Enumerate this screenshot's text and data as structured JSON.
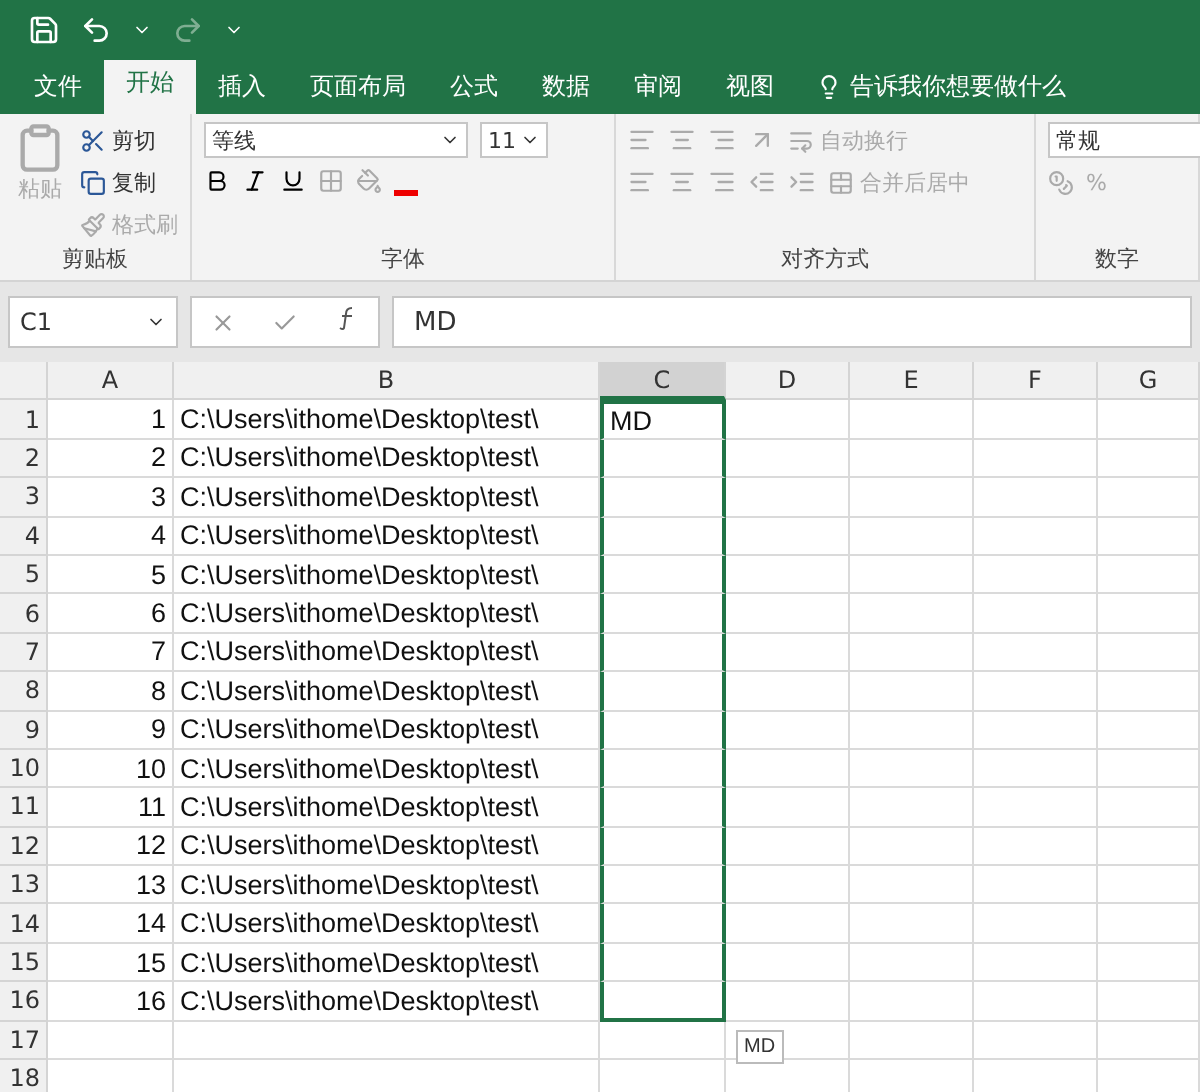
{
  "tabs": [
    {
      "label": "文件",
      "selected": false
    },
    {
      "label": "开始",
      "selected": true
    },
    {
      "label": "插入",
      "selected": false
    },
    {
      "label": "页面布局",
      "selected": false
    },
    {
      "label": "公式",
      "selected": false
    },
    {
      "label": "数据",
      "selected": false
    },
    {
      "label": "审阅",
      "selected": false
    },
    {
      "label": "视图",
      "selected": false
    }
  ],
  "tell_me": "告诉我你想要做什么",
  "ribbon": {
    "clipboard": {
      "label": "剪贴板",
      "paste": {
        "label": "粘贴",
        "disabled": true
      },
      "items": [
        {
          "kind": "cut",
          "label": "剪切",
          "disabled": false
        },
        {
          "kind": "copy",
          "label": "复制",
          "disabled": false
        },
        {
          "kind": "painter",
          "label": "格式刷",
          "disabled": true
        }
      ]
    },
    "font": {
      "label": "字体",
      "font_name": "等线",
      "font_size": "11"
    },
    "alignment": {
      "label": "对齐方式",
      "wrap": {
        "label": "自动换行",
        "disabled": true
      },
      "merge": {
        "label": "合并后居中",
        "disabled": true
      }
    },
    "number": {
      "label": "数字",
      "format": "常规",
      "percent": "%"
    }
  },
  "formula_bar": {
    "name_box": "C1",
    "formula": "MD"
  },
  "columns": [
    {
      "label": "A",
      "selected": false
    },
    {
      "label": "B",
      "selected": false
    },
    {
      "label": "C",
      "selected": true
    },
    {
      "label": "D",
      "selected": false
    },
    {
      "label": "E",
      "selected": false
    },
    {
      "label": "F",
      "selected": false
    },
    {
      "label": "G",
      "selected": false
    }
  ],
  "rows": [
    {
      "number": "1",
      "a": "1",
      "b": "C:\\Users\\ithome\\Desktop\\test\\",
      "c": "MD",
      "selected": true
    },
    {
      "number": "2",
      "a": "2",
      "b": "C:\\Users\\ithome\\Desktop\\test\\",
      "selected": true
    },
    {
      "number": "3",
      "a": "3",
      "b": "C:\\Users\\ithome\\Desktop\\test\\",
      "selected": true
    },
    {
      "number": "4",
      "a": "4",
      "b": "C:\\Users\\ithome\\Desktop\\test\\",
      "selected": true
    },
    {
      "number": "5",
      "a": "5",
      "b": "C:\\Users\\ithome\\Desktop\\test\\",
      "selected": true
    },
    {
      "number": "6",
      "a": "6",
      "b": "C:\\Users\\ithome\\Desktop\\test\\",
      "selected": true
    },
    {
      "number": "7",
      "a": "7",
      "b": "C:\\Users\\ithome\\Desktop\\test\\",
      "selected": true
    },
    {
      "number": "8",
      "a": "8",
      "b": "C:\\Users\\ithome\\Desktop\\test\\",
      "selected": true
    },
    {
      "number": "9",
      "a": "9",
      "b": "C:\\Users\\ithome\\Desktop\\test\\",
      "selected": true
    },
    {
      "number": "10",
      "a": "10",
      "b": "C:\\Users\\ithome\\Desktop\\test\\",
      "selected": true
    },
    {
      "number": "11",
      "a": "11",
      "b": "C:\\Users\\ithome\\Desktop\\test\\",
      "selected": true
    },
    {
      "number": "12",
      "a": "12",
      "b": "C:\\Users\\ithome\\Desktop\\test\\",
      "selected": true
    },
    {
      "number": "13",
      "a": "13",
      "b": "C:\\Users\\ithome\\Desktop\\test\\",
      "selected": true
    },
    {
      "number": "14",
      "a": "14",
      "b": "C:\\Users\\ithome\\Desktop\\test\\",
      "selected": true
    },
    {
      "number": "15",
      "a": "15",
      "b": "C:\\Users\\ithome\\Desktop\\test\\",
      "selected": true
    },
    {
      "number": "16",
      "a": "16",
      "b": "C:\\Users\\ithome\\Desktop\\test\\",
      "selected": true
    },
    {
      "number": "17",
      "selected": false
    },
    {
      "number": "18",
      "selected": false
    }
  ],
  "flash_fill_hint": "MD"
}
